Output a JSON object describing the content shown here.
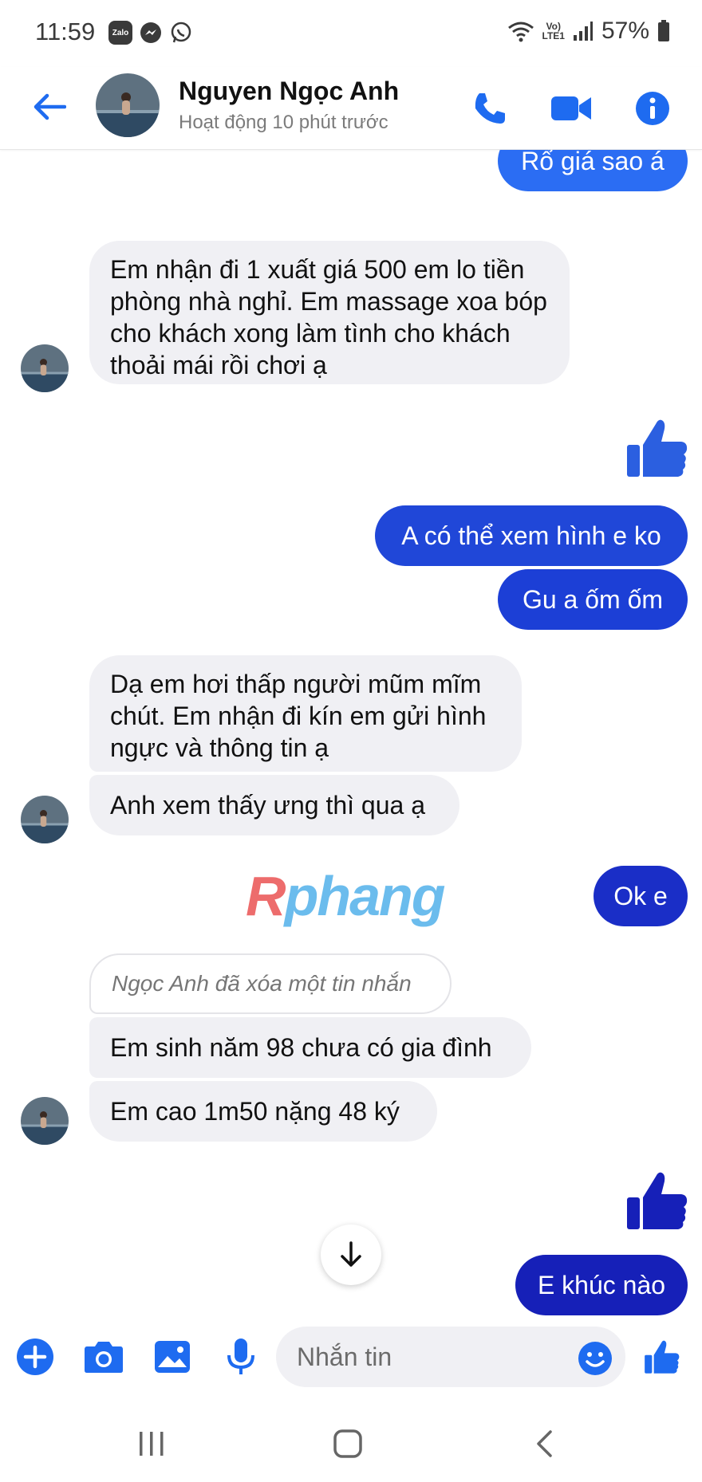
{
  "status_bar": {
    "time": "11:59",
    "apps": [
      "zalo-icon",
      "messenger-icon",
      "whatsapp-icon"
    ],
    "zalo_label": "Zalo",
    "lte_line1": "Vo)",
    "lte_line2": "LTE1",
    "battery": "57%"
  },
  "header": {
    "contact_name": "Nguyen Ngọc Anh",
    "contact_status": "Hoạt động 10 phút trước"
  },
  "colors": {
    "messenger_blue": "#1e6bf0",
    "sent_bubble_top": "#2b6df3",
    "sent_bubble_mid": "#1c3fd6",
    "sent_bubble_bottom": "#1620b8",
    "received_bubble": "#f0f0f4"
  },
  "messages": {
    "m1_sent": "Rổ giá sao á",
    "m2_recv": "Em nhận đi 1 xuất giá 500 em lo tiền phòng nhà nghỉ. Em massage xoa bóp cho khách xong làm tình cho khách thoải mái rồi chơi ạ",
    "m3_sent_like": "thumbs-up-icon",
    "m4_sent": "A có thể xem hình e ko",
    "m5_sent": "Gu a ốm ốm",
    "m6_recv": "Dạ em hơi thấp người mũm mĩm chút. Em nhận đi kín em gửi hình ngực và thông tin ạ",
    "m7_recv": "Anh xem thấy ưng thì qua ạ",
    "m8_sent": "Ok e",
    "m9_deleted": "Ngọc Anh đã xóa một tin nhắn",
    "m10_recv": "Em sinh năm 98 chưa có gia đình",
    "m11_recv": "Em cao 1m50 nặng 48 ký",
    "m12_sent_like": "thumbs-up-icon",
    "m13_sent": "E khúc nào"
  },
  "watermark": {
    "part1": "R",
    "part2": "phang"
  },
  "composer": {
    "placeholder": "Nhắn tin"
  }
}
